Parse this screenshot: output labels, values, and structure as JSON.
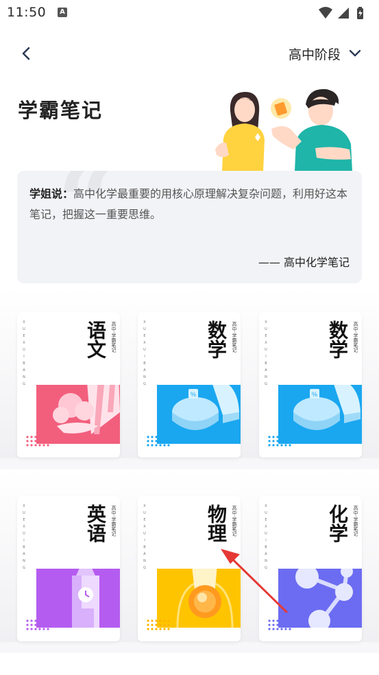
{
  "status_bar": {
    "time": "11:50",
    "notification_icon": "A"
  },
  "nav": {
    "back_icon": "chevron-left-icon",
    "stage_label": "高中阶段",
    "dropdown_icon": "chevron-down-icon"
  },
  "header": {
    "title": "学霸笔记"
  },
  "quote": {
    "prefix": "学姐说：",
    "text": "高中化学最重要的用核心原理解决复杂问题，利用好这本笔记，把握这一重要思维。",
    "source": "—— 高中化学笔记"
  },
  "books": [
    {
      "title": "语文",
      "tag": "高中·学霸笔记",
      "pinyin": "XUEXUIBANG",
      "color": "#f25f7d"
    },
    {
      "title": "数学",
      "tag": "高中·学霸笔记",
      "pinyin": "XUEXUIBANG",
      "color": "#1aa7f0"
    },
    {
      "title": "数学",
      "tag": "高中·学霸笔记",
      "pinyin": "XUEXUIBANG",
      "color": "#1aa7f0"
    },
    {
      "title": "英语",
      "tag": "高中·学霸笔记",
      "pinyin": "XUEXUIBANG",
      "color": "#b55cf0"
    },
    {
      "title": "物理",
      "tag": "高中·学霸笔记",
      "pinyin": "XUEXUIBANG",
      "color": "#ffc400"
    },
    {
      "title": "化学",
      "tag": "高中·学霸笔记",
      "pinyin": "XUEXUIBANG",
      "color": "#6c6cf2"
    }
  ],
  "accent_color": "#e53935"
}
